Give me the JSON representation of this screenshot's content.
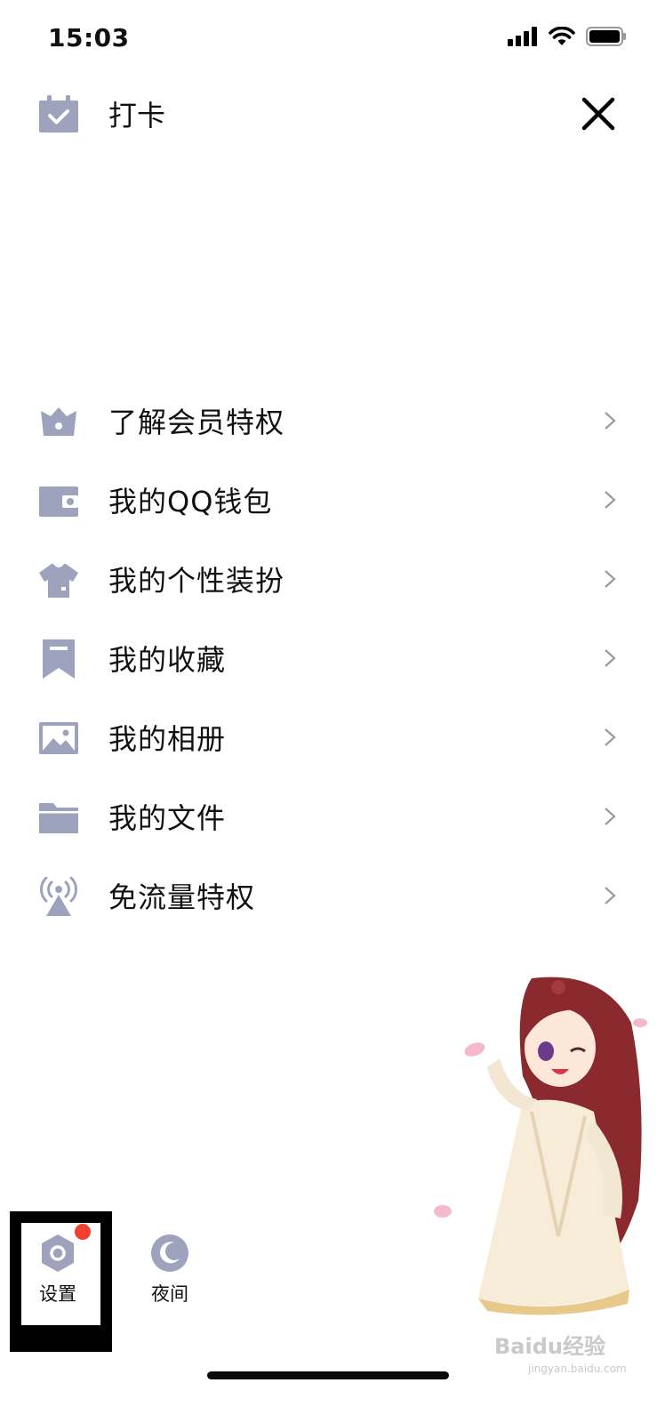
{
  "status_bar": {
    "time": "15:03"
  },
  "header": {
    "checkin_label": "打卡"
  },
  "menu": {
    "items": [
      {
        "label": "了解会员特权",
        "icon": "crown-icon"
      },
      {
        "label": "我的QQ钱包",
        "icon": "wallet-icon"
      },
      {
        "label": "我的个性装扮",
        "icon": "shirt-icon"
      },
      {
        "label": "我的收藏",
        "icon": "bookmark-icon"
      },
      {
        "label": "我的相册",
        "icon": "photo-icon"
      },
      {
        "label": "我的文件",
        "icon": "folder-icon"
      },
      {
        "label": "免流量特权",
        "icon": "signal-tower-icon"
      }
    ]
  },
  "bottom": {
    "settings_label": "设置",
    "night_label": "夜间",
    "settings_has_notification": true
  },
  "watermark": {
    "brand": "Baidu经验",
    "url": "jingyan.baidu.com"
  },
  "colors": {
    "icon": "#9ea3bd",
    "badge": "#f0412f",
    "text": "#111111"
  }
}
